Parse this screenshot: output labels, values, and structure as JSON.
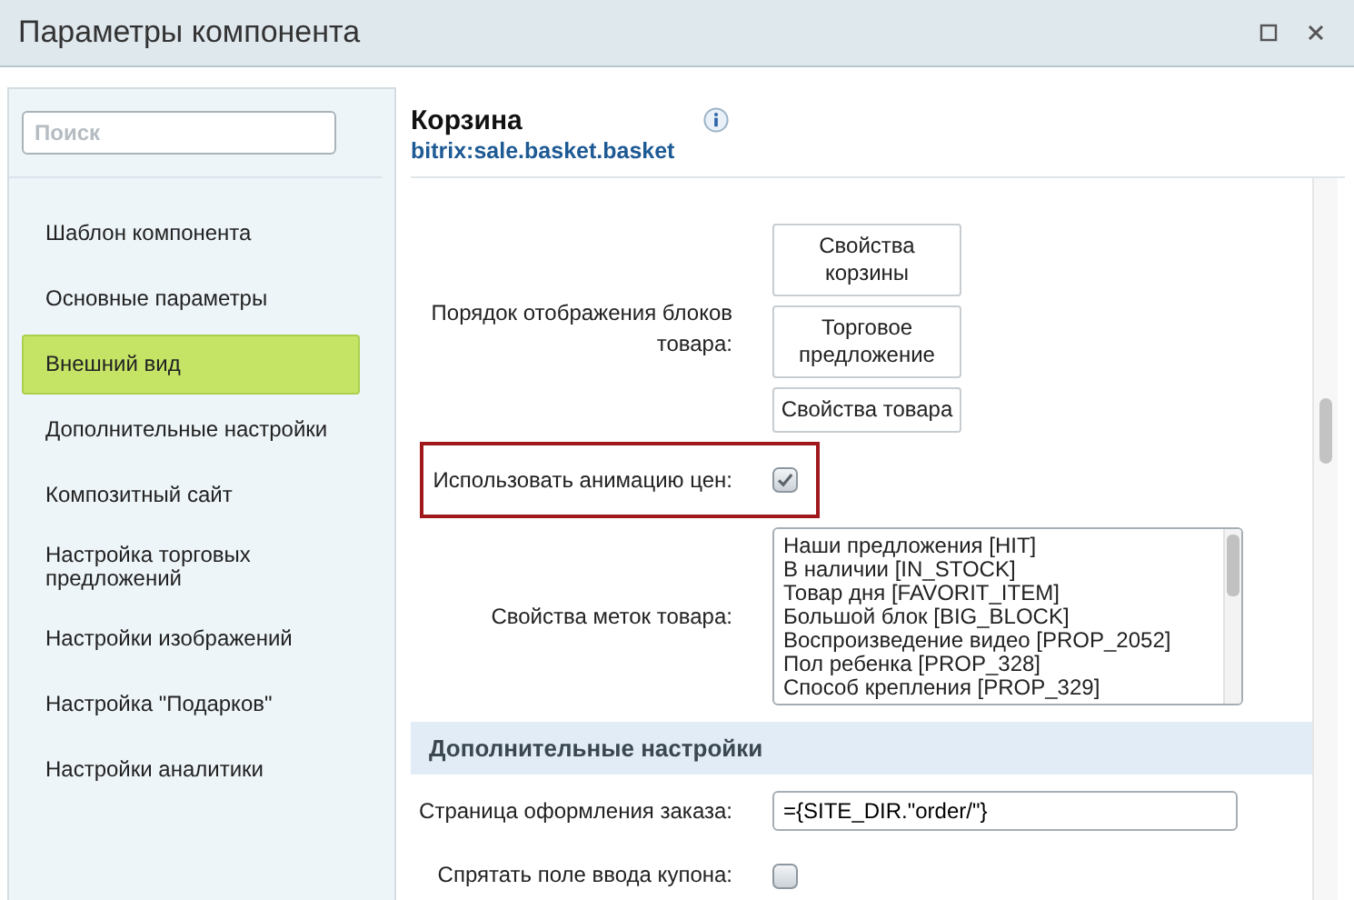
{
  "window": {
    "title": "Параметры компонента"
  },
  "sidebar": {
    "search": {
      "placeholder": "Поиск"
    },
    "items": [
      {
        "label": "Шаблон компонента",
        "selected": false
      },
      {
        "label": "Основные параметры",
        "selected": false
      },
      {
        "label": "Внешний вид",
        "selected": true
      },
      {
        "label": "Дополнительные настройки",
        "selected": false
      },
      {
        "label": "Композитный сайт",
        "selected": false
      },
      {
        "label": "Настройка торговых предложений",
        "selected": false
      },
      {
        "label": "Настройки изображений",
        "selected": false
      },
      {
        "label": "Настройка \"Подарков\"",
        "selected": false
      },
      {
        "label": "Настройки аналитики",
        "selected": false
      }
    ]
  },
  "component": {
    "title": "Корзина",
    "code": "bitrix:sale.basket.basket"
  },
  "rows": [
    {
      "kind": "buttons",
      "label": "Порядок отображения блоков товара:",
      "highlighted": false,
      "buttons": [
        "Свойства корзины",
        "Торговое предложение",
        "Свойства товара"
      ]
    },
    {
      "kind": "checkbox",
      "label": "Использовать анимацию цен:",
      "highlighted": true,
      "checked": true
    },
    {
      "kind": "listbox",
      "label": "Свойства меток товара:",
      "highlighted": false,
      "options": [
        "Наши предложения [HIT]",
        "В наличии [IN_STOCK]",
        "Товар дня [FAVORIT_ITEM]",
        "Большой блок [BIG_BLOCK]",
        "Воспроизведение видео [PROP_2052]",
        "Пол ребенка [PROP_328]",
        "Способ крепления [PROP_329]"
      ]
    },
    {
      "kind": "section",
      "label": "Дополнительные настройки"
    },
    {
      "kind": "text",
      "label": "Страница оформления заказа:",
      "highlighted": false,
      "value": "={SITE_DIR.\"order/\"}"
    },
    {
      "kind": "checkbox",
      "label": "Спрятать поле ввода купона:",
      "highlighted": false,
      "checked": false
    }
  ]
}
